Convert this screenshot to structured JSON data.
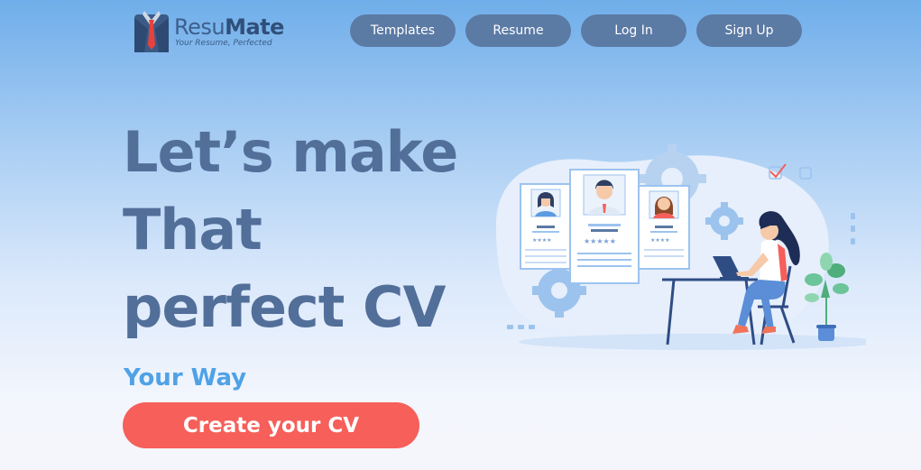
{
  "brand": {
    "name_light": "Resu",
    "name_bold": "Mate",
    "tagline": "Your Resume, Perfected",
    "icon": "suit-tie-icon"
  },
  "nav": {
    "templates": "Templates",
    "resume": "Resume",
    "login": "Log In",
    "signup": "Sign Up"
  },
  "hero": {
    "line1": "Let’s make",
    "line2": "That",
    "line3": "perfect CV",
    "subtitle": "Your Way",
    "cta": "Create your CV"
  },
  "colors": {
    "nav_button": "#5b7aa4",
    "headline": "#526f9a",
    "subtitle": "#4fa2e6",
    "cta": "#f65f5a"
  }
}
